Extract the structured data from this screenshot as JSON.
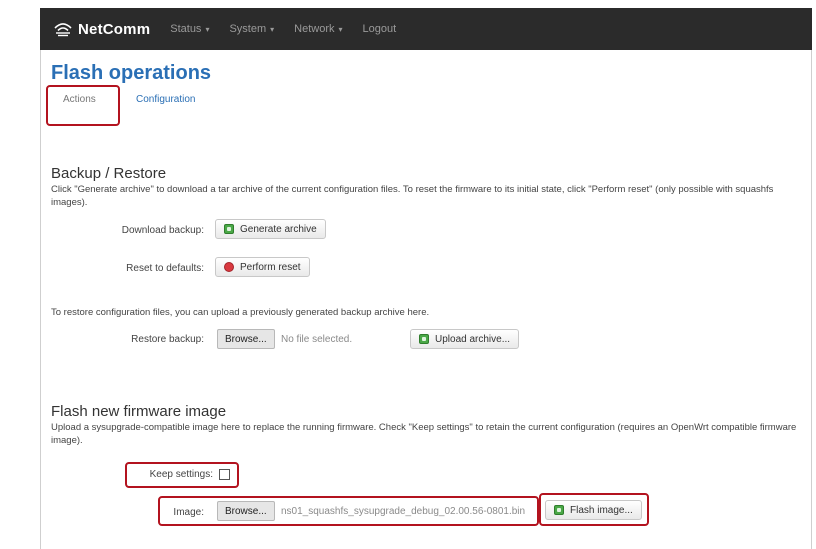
{
  "brand": {
    "name": "NetComm"
  },
  "nav": [
    {
      "label": "Status",
      "caret": "▾"
    },
    {
      "label": "System",
      "caret": "▾"
    },
    {
      "label": "Network",
      "caret": "▾"
    },
    {
      "label": "Logout"
    }
  ],
  "page": {
    "title": "Flash operations"
  },
  "tabs": [
    {
      "label": "Actions",
      "active": true
    },
    {
      "label": "Configuration"
    }
  ],
  "backup": {
    "heading": "Backup / Restore",
    "description": "Click \"Generate archive\" to download a tar archive of the current configuration files. To reset the firmware to its initial state, click \"Perform reset\" (only possible with squashfs images).",
    "download_label": "Download backup:",
    "generate_button": "Generate archive",
    "reset_label": "Reset to defaults:",
    "reset_button": "Perform reset",
    "restore_note": "To restore configuration files, you can upload a previously generated backup archive here.",
    "restore_label": "Restore backup:",
    "browse_button": "Browse...",
    "file_status": "No file selected.",
    "upload_button": "Upload archive..."
  },
  "flash": {
    "heading": "Flash new firmware image",
    "description": "Upload a sysupgrade-compatible image here to replace the running firmware. Check \"Keep settings\" to retain the current configuration (requires an OpenWrt compatible firmware image).",
    "keep_label": "Keep settings:",
    "keep_checked": false,
    "image_label": "Image:",
    "browse_button": "Browse...",
    "file_name": "ns01_squashfs_sysupgrade_debug_02.00.56-0801.bin",
    "flash_button": "Flash image..."
  },
  "colors": {
    "accent": "#2a6fb5",
    "highlight": "#b3131f",
    "navbar": "#2b2b2b"
  }
}
